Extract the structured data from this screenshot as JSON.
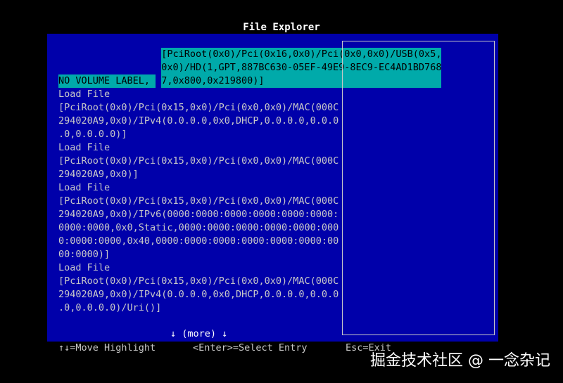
{
  "window": {
    "title": "File Explorer"
  },
  "entries": [
    {
      "title": "NO VOLUME LABEL,",
      "path_lines": [
        "[PciRoot(0x0)/Pci(0x16,0x0)/Pci(0x0,0x0)/USB(0x5,",
        "0x0)/HD(1,GPT,887BC630-05EF-49E9-8EC9-EC4AD1BD768",
        "7,0x800,0x219800)]"
      ],
      "selected": true
    },
    {
      "title": "Load File",
      "path_lines": [
        "[PciRoot(0x0)/Pci(0x15,0x0)/Pci(0x0,0x0)/MAC(000C",
        "294020A9,0x0)/IPv4(0.0.0.0,0x0,DHCP,0.0.0.0,0.0.0",
        ".0,0.0.0.0)]"
      ],
      "selected": false
    },
    {
      "title": "Load File",
      "path_lines": [
        "[PciRoot(0x0)/Pci(0x15,0x0)/Pci(0x0,0x0)/MAC(000C",
        "294020A9,0x0)]"
      ],
      "selected": false
    },
    {
      "title": "Load File",
      "path_lines": [
        "[PciRoot(0x0)/Pci(0x15,0x0)/Pci(0x0,0x0)/MAC(000C",
        "294020A9,0x0)/IPv6(0000:0000:0000:0000:0000:0000:",
        "0000:0000,0x0,Static,0000:0000:0000:0000:0000:000",
        "0:0000:0000,0x40,0000:0000:0000:0000:0000:0000:00",
        "00:0000)]"
      ],
      "selected": false
    },
    {
      "title": "Load File",
      "path_lines": [
        "[PciRoot(0x0)/Pci(0x15,0x0)/Pci(0x0,0x0)/MAC(000C",
        "294020A9,0x0)/IPv4(0.0.0.0,0x0,DHCP,0.0.0.0,0.0.0",
        ".0,0.0.0.0)/Uri()]"
      ],
      "selected": false
    }
  ],
  "more_indicator": "↓ (more) ↓",
  "status_bar": {
    "move_hint": "↑↓=Move Highlight",
    "enter_hint": "<Enter>=Select Entry",
    "esc_hint": "Esc=Exit"
  },
  "watermark": "掘金技术社区 @ 一念杂记",
  "colors": {
    "background": "#000000",
    "panel": "#0000aa",
    "highlight": "#00aaaa",
    "text": "#c8c8c8",
    "title": "#ffffff"
  }
}
